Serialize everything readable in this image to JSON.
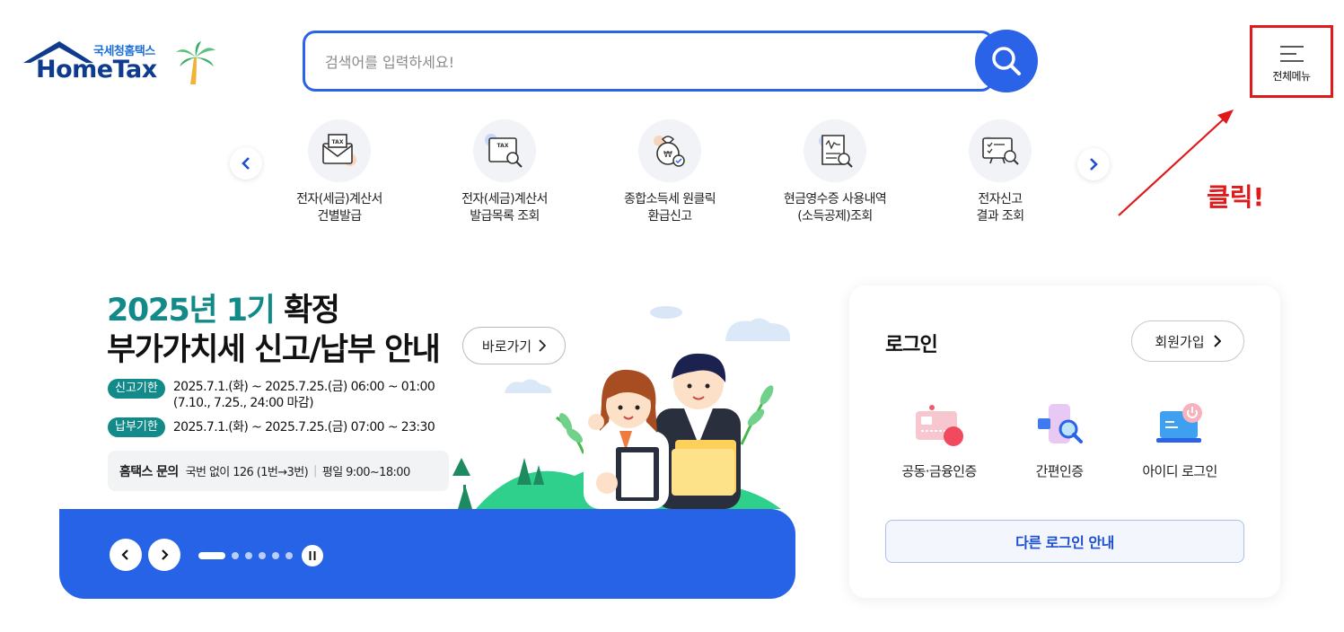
{
  "header": {
    "logo_sub": "국세청홈택스",
    "logo_main": "HomeTax",
    "search_placeholder": "검색어를 입력하세요!",
    "all_menu_label": "전체메뉴"
  },
  "quick_menu": {
    "items": [
      {
        "line1": "전자(세금)계산서",
        "line2": "건별발급",
        "icon": "tax-envelope-icon"
      },
      {
        "line1": "전자(세금)계산서",
        "line2": "발급목록 조회",
        "icon": "tax-search-icon"
      },
      {
        "line1": "종합소득세 원클릭",
        "line2": "환급신고",
        "icon": "money-bag-icon"
      },
      {
        "line1": "현금영수증 사용내역",
        "line2": "(소득공제)조회",
        "icon": "receipt-search-icon"
      },
      {
        "line1": "전자신고",
        "line2": "결과 조회",
        "icon": "monitor-check-icon"
      }
    ]
  },
  "annotation": {
    "text": "클릭!",
    "color": "#e0191b"
  },
  "banner": {
    "title_accent": "2025년 1기",
    "title_part1": "확정",
    "title_line2": "부가가치세 신고/납부 안내",
    "goto_label": "바로가기",
    "report_badge": "신고기한",
    "report_line1": "2025.7.1.(화) ~ 2025.7.25.(금) 06:00 ~ 01:00",
    "report_line2": "(7.10., 7.25., 24:00 마감)",
    "pay_badge": "납부기한",
    "pay_line": "2025.7.1.(화) ~ 2025.7.25.(금) 07:00 ~ 23:30",
    "inquiry_title": "홈택스 문의",
    "inquiry_phone": "국번 없이 126 (1번→3번)",
    "inquiry_hours": "평일 9:00~18:00",
    "slide_count": 6,
    "active_slide": 1
  },
  "login": {
    "title": "로그인",
    "join_label": "회원가입",
    "options": [
      {
        "label": "공동·금융인증",
        "icon": "certificate-card-icon"
      },
      {
        "label": "간편인증",
        "icon": "phone-search-icon"
      },
      {
        "label": "아이디 로그인",
        "icon": "laptop-power-icon"
      }
    ],
    "other_login": "다른 로그인 안내"
  },
  "colors": {
    "primary": "#2a63e8",
    "teal": "#138a8a",
    "annotation_red": "#e0191b"
  }
}
